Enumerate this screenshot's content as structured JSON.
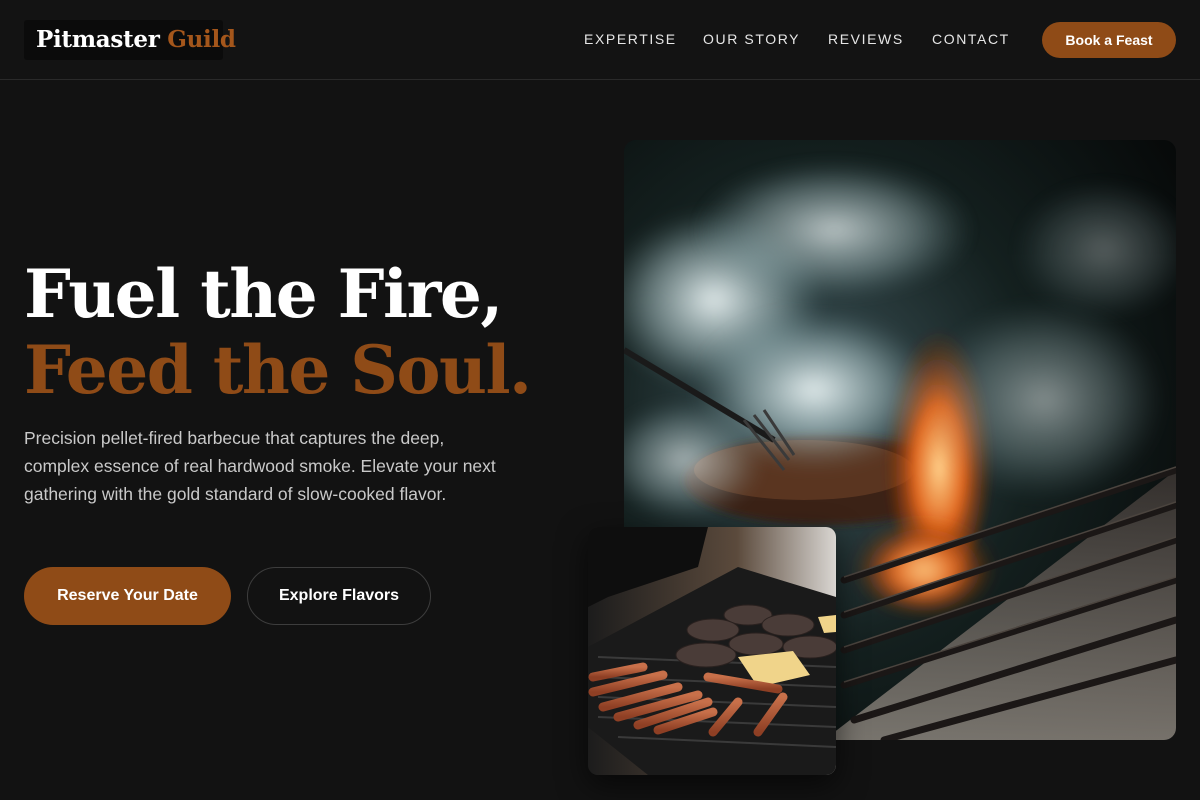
{
  "brand": {
    "name_part1": "Pitmaster",
    "name_part2": "Guild",
    "accent_color": "#8f4b17",
    "background_color": "#121212"
  },
  "nav": {
    "links": [
      "EXPERTISE",
      "OUR STORY",
      "REVIEWS",
      "CONTACT"
    ],
    "cta_label": "Book a Feast"
  },
  "hero": {
    "headline_line1": "Fuel the Fire,",
    "headline_line2": "Feed the Soul.",
    "description": "Precision pellet-fired barbecue that captures the deep, complex essence of real hardwood smoke. Elevate your next gathering with the gold standard of slow-cooked flavor.",
    "primary_button": "Reserve Your Date",
    "secondary_button": "Explore Flavors"
  },
  "images": {
    "main_icon": "smoky-grill-photo",
    "secondary_icon": "grill-burgers-hotdogs-photo"
  }
}
